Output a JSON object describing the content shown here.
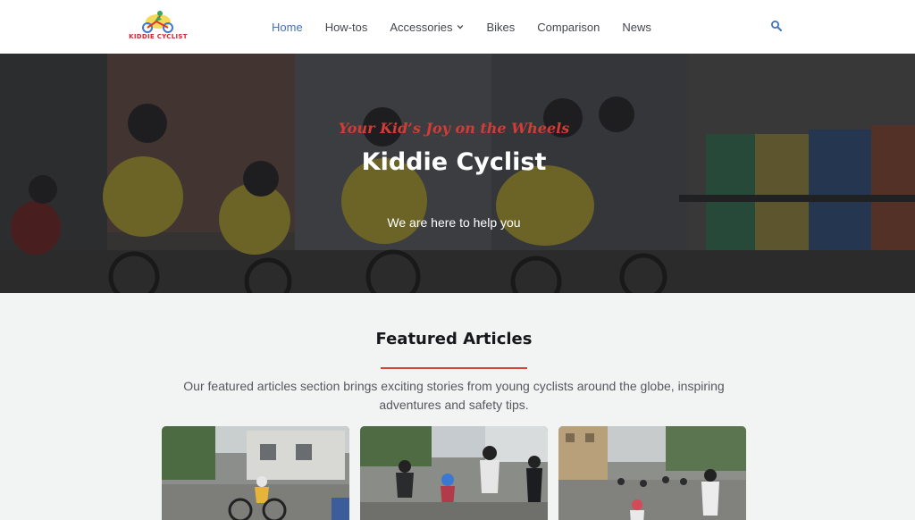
{
  "logo": {
    "text": "KIDDIE CYCLIST"
  },
  "nav": {
    "items": [
      {
        "label": "Home",
        "active": true
      },
      {
        "label": "How-tos"
      },
      {
        "label": "Accessories",
        "has_dropdown": true
      },
      {
        "label": "Bikes"
      },
      {
        "label": "Comparison"
      },
      {
        "label": "News"
      }
    ],
    "search_icon": "search-icon"
  },
  "hero": {
    "tagline": "Your Kid’s Joy on the Wheels",
    "title": "Kiddie Cyclist",
    "subtitle": "We are here to help you"
  },
  "featured": {
    "title": "Featured Articles",
    "description": "Our featured articles section brings exciting stories from young cyclists around the globe, inspiring adventures and safety tips."
  },
  "colors": {
    "accent": "#4471b4",
    "brand_red": "#d3262a",
    "divider": "#d4463a"
  }
}
